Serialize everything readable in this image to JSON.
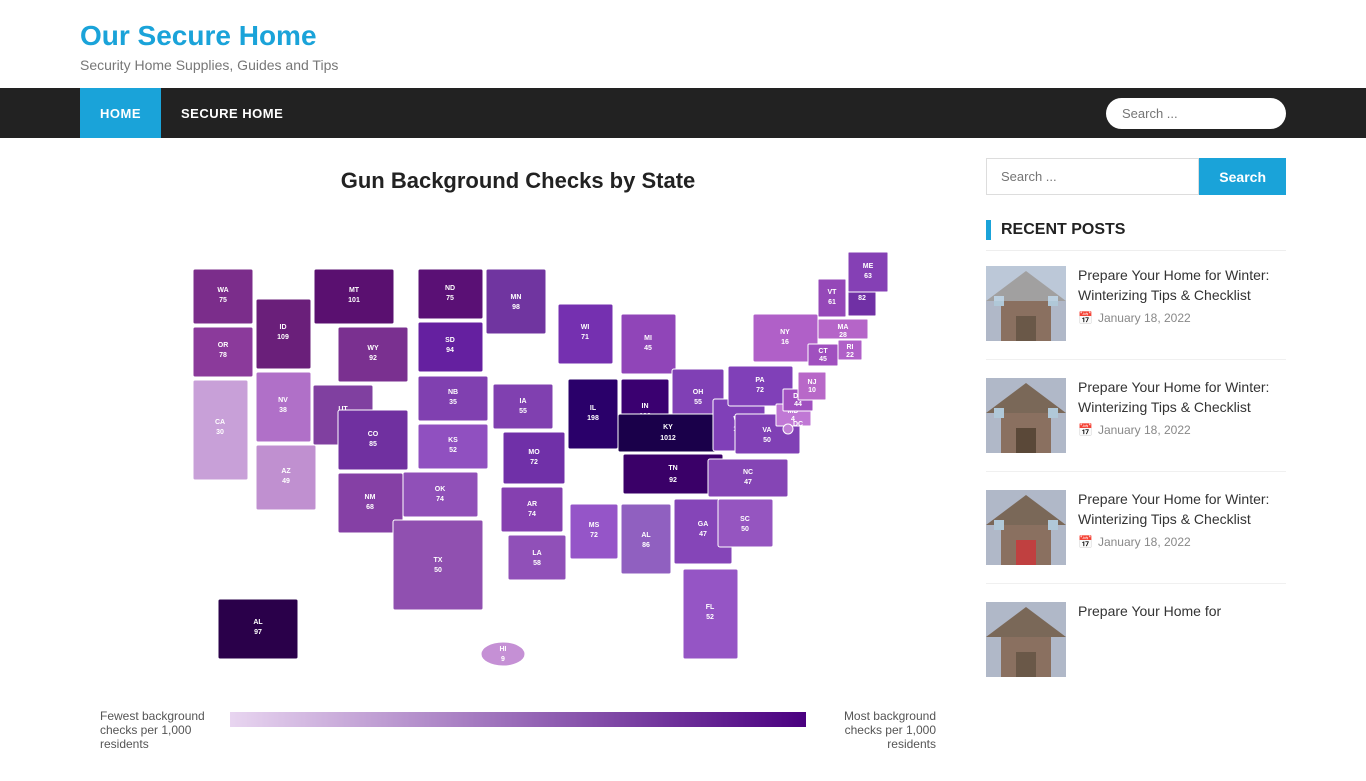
{
  "site": {
    "title": "Our Secure Home",
    "tagline": "Security Home Supplies, Guides and Tips"
  },
  "nav": {
    "items": [
      {
        "label": "HOME",
        "active": true
      },
      {
        "label": "SECURE HOME",
        "active": false
      }
    ],
    "search_placeholder": "Search ..."
  },
  "map": {
    "title": "Gun Background Checks by State",
    "legend_left": "Fewest background checks per 1,000 residents",
    "legend_right": "Most background checks per 1,000 residents"
  },
  "sidebar": {
    "search_placeholder": "Search ...",
    "search_button": "Search",
    "recent_posts_header": "RECENT POSTS",
    "posts": [
      {
        "title": "Prepare Your Home for Winter: Winterizing Tips & Checklist",
        "date": "January 18, 2022"
      },
      {
        "title": "Prepare Your Home for Winter: Winterizing Tips & Checklist",
        "date": "January 18, 2022"
      },
      {
        "title": "Prepare Your Home for Winter: Winterizing Tips & Checklist",
        "date": "January 18, 2022"
      },
      {
        "title": "Prepare Your Home for",
        "date": ""
      }
    ]
  }
}
